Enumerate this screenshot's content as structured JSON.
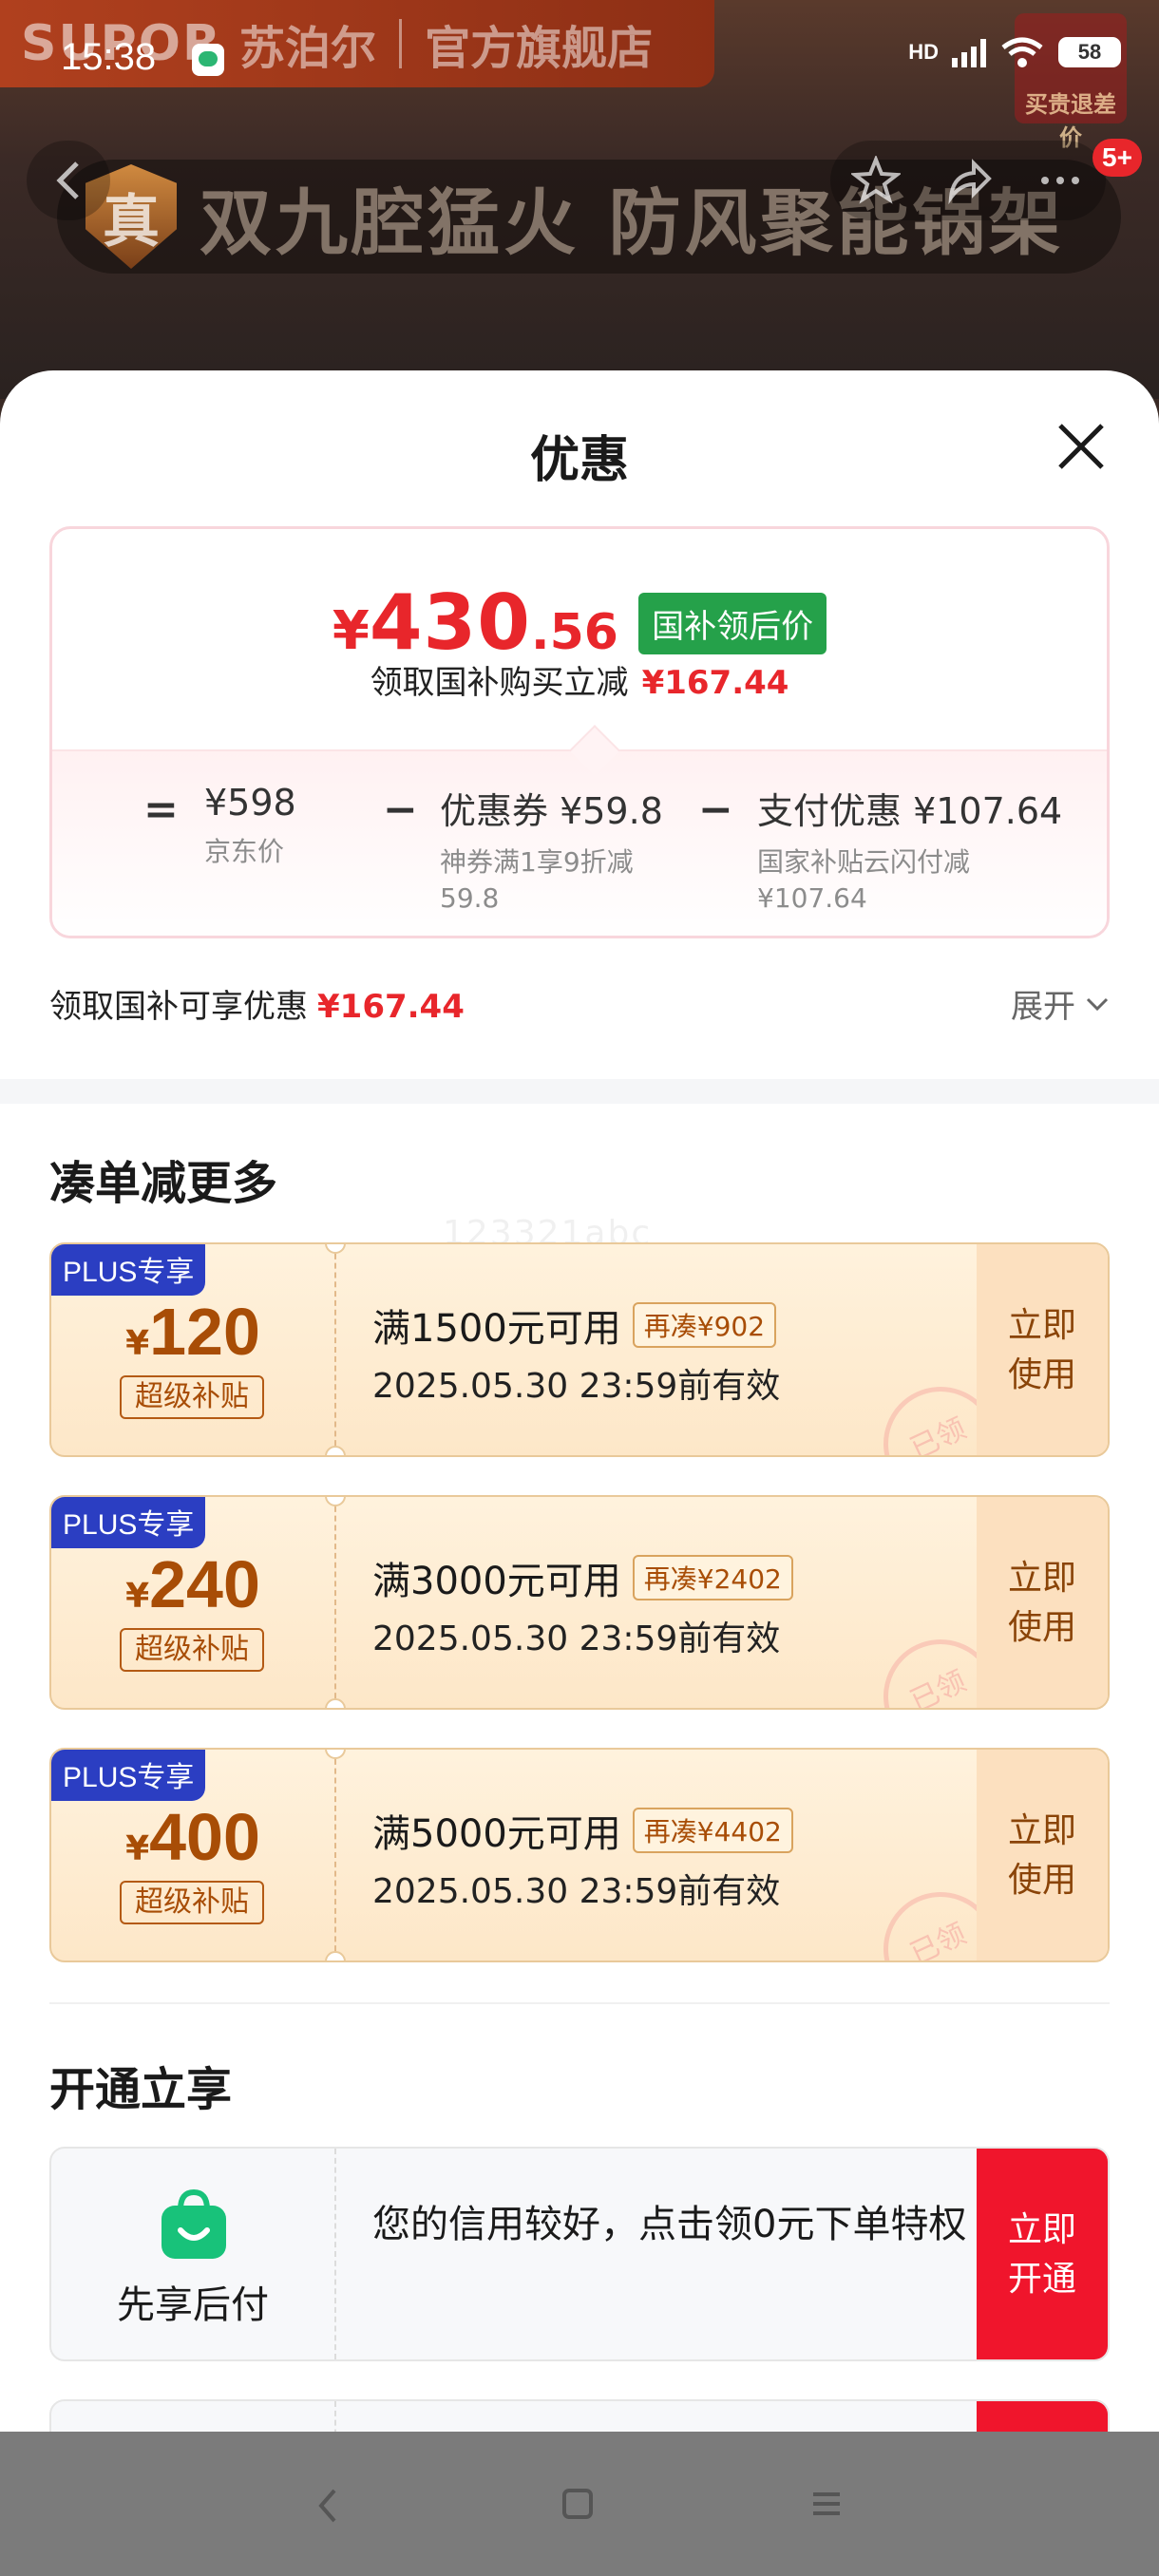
{
  "status_bar": {
    "time": "15:38",
    "network": "HD",
    "signal_sub": "6",
    "battery": "58"
  },
  "banner": {
    "brand_logo": "SUPOR",
    "brand_name": "苏泊尔",
    "brand_flag": "官方旗舰店",
    "slogan_badge": "真",
    "slogan": "双九腔猛火 防风聚能锅架",
    "price_tag": "买贵退差价",
    "cart_badge": "5+"
  },
  "sheet": {
    "title": "优惠",
    "price": {
      "yen": "¥",
      "integer": "430",
      "decimal": ".56",
      "tag": "国补领后价"
    },
    "subsidy_line": {
      "label": "领取国补购买立减",
      "amount": "¥167.44"
    },
    "breakdown": {
      "eq": "=",
      "jd_price": {
        "value": "¥598",
        "note": "京东价"
      },
      "minus1": "−",
      "coupon": {
        "value": "优惠券 ¥59.8",
        "note1": "神券满1享9折减",
        "note2": "59.8"
      },
      "minus2": "−",
      "payment": {
        "value": "支付优惠 ¥107.64",
        "note1": "国家补贴云闪付减",
        "note2": "¥107.64"
      }
    },
    "gov_row": {
      "label": "领取国补可享优惠",
      "amount": "¥167.44",
      "expand": "展开"
    },
    "section_more": "凑单减更多",
    "watermark": "123321abc",
    "coupons": [
      {
        "plus": "PLUS专享",
        "yen": "¥",
        "amount": "120",
        "subsidy": "超级补贴",
        "condition": "满1500元可用",
        "need": "再凑¥902",
        "valid": "2025.05.30 23:59前有效",
        "use": [
          "立即",
          "使用"
        ],
        "stamp": "已领"
      },
      {
        "plus": "PLUS专享",
        "yen": "¥",
        "amount": "240",
        "subsidy": "超级补贴",
        "condition": "满3000元可用",
        "need": "再凑¥2402",
        "valid": "2025.05.30 23:59前有效",
        "use": [
          "立即",
          "使用"
        ],
        "stamp": "已领"
      },
      {
        "plus": "PLUS专享",
        "yen": "¥",
        "amount": "400",
        "subsidy": "超级补贴",
        "condition": "满5000元可用",
        "need": "再凑¥4402",
        "valid": "2025.05.30 23:59前有效",
        "use": [
          "立即",
          "使用"
        ],
        "stamp": "已领"
      }
    ],
    "section_open": "开通立享",
    "pay_later": {
      "label": "先享后付",
      "text": "您的信用较好，点击领0元下单特权",
      "button": [
        "立即",
        "开通"
      ]
    }
  },
  "colors": {
    "accent_red": "#e8262b",
    "gov_green": "#25a14a",
    "plus_blue": "#2b3ec2",
    "coupon_brown": "#a84d06"
  },
  "icons": [
    "back-icon",
    "star-icon",
    "share-icon",
    "more-icon",
    "close-icon",
    "chevron-down-icon",
    "shopping-bag-icon",
    "nav-back-icon",
    "nav-home-icon",
    "nav-menu-icon"
  ]
}
